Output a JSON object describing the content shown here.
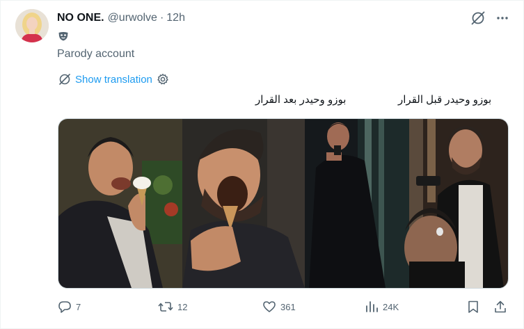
{
  "tweet": {
    "author_name": "NO ONE.",
    "handle": "@urwolve",
    "separator": "·",
    "time": "12h",
    "parody_label": "Parody account",
    "show_translation": "Show translation",
    "caption_left": "بوزو وحيدر بعد القرار",
    "caption_right": "بوزو وحيدر قبل القرار"
  },
  "media": {
    "panels": [
      "ice-cream-panel-1",
      "ice-cream-panel-2",
      "gun-panel-1",
      "gun-panel-2"
    ]
  },
  "actions": {
    "replies": "7",
    "reposts": "12",
    "likes": "361",
    "views": "24K"
  },
  "colors": {
    "accent": "#1d9bf0",
    "secondary_text": "#536471",
    "primary_text": "#0f1419"
  },
  "icons": {
    "grok": "grok-icon",
    "more": "more-icon",
    "mask": "parody-mask-icon",
    "translate": "translate-icon",
    "settings": "settings-gear-icon",
    "reply": "reply-icon",
    "repost": "repost-icon",
    "like": "like-icon",
    "views": "views-icon",
    "bookmark": "bookmark-icon",
    "share": "share-icon"
  }
}
